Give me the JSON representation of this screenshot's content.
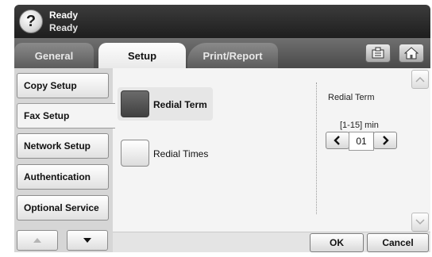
{
  "status": {
    "title": "Ready",
    "subtitle": "Ready",
    "help_icon": "?"
  },
  "tabs": [
    {
      "label": "General",
      "active": false
    },
    {
      "label": "Setup",
      "active": true
    },
    {
      "label": "Print/Report",
      "active": false
    }
  ],
  "toolbar": {
    "job_status_icon": "job-status-icon",
    "home_icon": "home-icon"
  },
  "menu": {
    "items": [
      {
        "label": "Copy Setup",
        "active": false
      },
      {
        "label": "Fax Setup",
        "active": true
      },
      {
        "label": "Network Setup",
        "active": false
      },
      {
        "label": "Authentication",
        "active": false
      },
      {
        "label": "Optional Service",
        "active": false
      }
    ]
  },
  "options": [
    {
      "label": "Redial Term",
      "selected": true
    },
    {
      "label": "Redial Times",
      "selected": false
    }
  ],
  "detail": {
    "title": "Redial Term",
    "range": "[1-15] min",
    "value": "01"
  },
  "buttons": {
    "ok": "OK",
    "cancel": "Cancel"
  },
  "colors": {
    "status_bar": "#2a2a2a",
    "tab_active": "#f4f4f4",
    "selected_option": "#555555"
  }
}
